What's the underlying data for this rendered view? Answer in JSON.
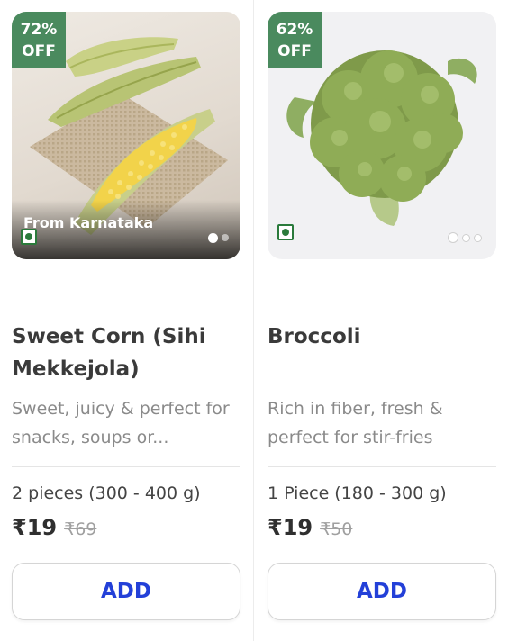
{
  "products": [
    {
      "discount_pct": "72%",
      "discount_off": "OFF",
      "origin": "From Karnataka",
      "name": "Sweet Corn (Sihi Mekkejola)",
      "description": "Sweet, juicy & perfect for snacks, soups or...",
      "quantity": "2 pieces",
      "weight": "(300 - 400 g)",
      "price": "₹19",
      "mrp": "₹69",
      "add_label": "ADD",
      "image_icon": "sweet-corn",
      "carousel_count": 2,
      "carousel_active": 1
    },
    {
      "discount_pct": "62%",
      "discount_off": "OFF",
      "name": "Broccoli",
      "description": "Rich in fiber, fresh & perfect for stir-fries",
      "quantity": "1 Piece",
      "weight": "(180 - 300 g)",
      "price": "₹19",
      "mrp": "₹50",
      "add_label": "ADD",
      "image_icon": "broccoli",
      "carousel_count": 3,
      "carousel_active": 1
    }
  ],
  "colors": {
    "discount_badge": "#4a8a5e",
    "add_text": "#2340d8",
    "veg_mark": "#2a7a3b"
  }
}
